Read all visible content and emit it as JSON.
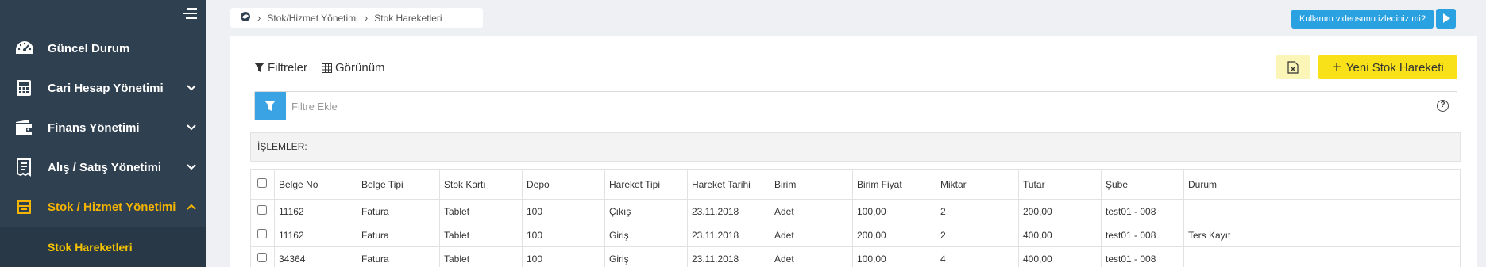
{
  "sidebar": {
    "items": [
      {
        "label": "Güncel Durum",
        "icon": "dashboard-icon",
        "expandable": false
      },
      {
        "label": "Cari Hesap Yönetimi",
        "icon": "calculator-icon",
        "expandable": true
      },
      {
        "label": "Finans Yönetimi",
        "icon": "wallet-icon",
        "expandable": true
      },
      {
        "label": "Alış / Satış Yönetimi",
        "icon": "receipt-icon",
        "expandable": true
      },
      {
        "label": "Stok / Hizmet Yönetimi",
        "icon": "box-icon",
        "expandable": true,
        "active": true
      }
    ],
    "sub_items": [
      {
        "label": "Stok Hareketleri"
      }
    ],
    "active_color": "#f5b400"
  },
  "breadcrumb": {
    "items": [
      "Stok/Hizmet Yönetimi",
      "Stok Hareketleri"
    ]
  },
  "help": {
    "video_label": "Kullanım videosunu izlediniz mi?"
  },
  "toolbar": {
    "filters_label": "Filtreler",
    "view_label": "Görünüm",
    "new_button_label": "Yeni Stok Hareketi",
    "excel_icon": "excel-export-icon"
  },
  "filter": {
    "placeholder": "Filtre Ekle",
    "help_label": "?"
  },
  "actions": {
    "label": "İŞLEMLER:"
  },
  "table": {
    "columns": [
      "Belge No",
      "Belge Tipi",
      "Stok Kartı",
      "Depo",
      "Hareket Tipi",
      "Hareket Tarihi",
      "Birim",
      "Birim Fiyat",
      "Miktar",
      "Tutar",
      "Şube",
      "Durum"
    ],
    "rows": [
      [
        "11162",
        "Fatura",
        "Tablet",
        "100",
        "Çıkış",
        "23.11.2018",
        "Adet",
        "100,00",
        "2",
        "200,00",
        "test01 - 008",
        ""
      ],
      [
        "11162",
        "Fatura",
        "Tablet",
        "100",
        "Giriş",
        "23.11.2018",
        "Adet",
        "200,00",
        "2",
        "400,00",
        "test01 - 008",
        "Ters Kayıt"
      ],
      [
        "34364",
        "Fatura",
        "Tablet",
        "100",
        "Giriş",
        "23.11.2018",
        "Adet",
        "100,00",
        "4",
        "400,00",
        "test01 - 008",
        ""
      ]
    ]
  },
  "colors": {
    "sidebar_bg": "#2f4050",
    "accent_yellow": "#f9e11a",
    "accent_blue": "#2aa1e0"
  }
}
